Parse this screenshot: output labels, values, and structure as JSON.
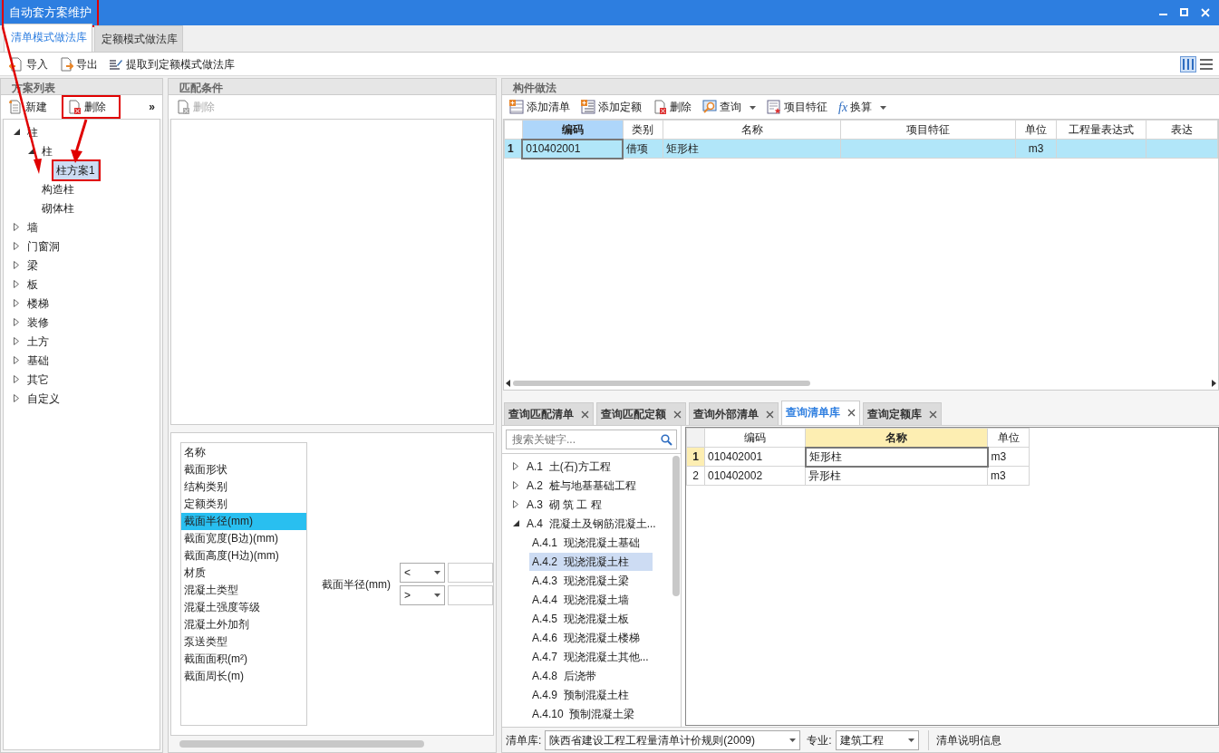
{
  "window": {
    "title": "自动套方案维护",
    "highlighted": true
  },
  "mode_tabs": [
    {
      "label": "清单模式做法库",
      "selected": true
    },
    {
      "label": "定额模式做法库",
      "selected": false
    }
  ],
  "toolbar": [
    {
      "label": "导入",
      "kind": "import"
    },
    {
      "label": "导出",
      "kind": "export"
    },
    {
      "label": "提取到定额模式做法库",
      "kind": "extract"
    }
  ],
  "scheme_panel": {
    "title": "方案列表",
    "more": "»",
    "buttons": [
      {
        "label": "新建",
        "kind": "new",
        "highlighted": false
      },
      {
        "label": "删除",
        "kind": "delete",
        "highlighted": true
      }
    ],
    "tree": [
      {
        "label": "柱",
        "expanded": true,
        "selected": false,
        "highlighted": false,
        "children": [
          {
            "label": "柱",
            "expanded": true,
            "selected": false,
            "highlighted": false,
            "children": [
              {
                "label": "柱方案1",
                "selected": true,
                "highlighted": true
              }
            ]
          },
          {
            "label": "构造柱",
            "selected": false,
            "highlighted": false
          },
          {
            "label": "砌体柱",
            "selected": false,
            "highlighted": false
          }
        ]
      },
      {
        "label": "墙",
        "expanded": false,
        "selected": false,
        "highlighted": false
      },
      {
        "label": "门窗洞",
        "expanded": false,
        "selected": false,
        "highlighted": false
      },
      {
        "label": "梁",
        "expanded": false,
        "selected": false,
        "highlighted": false
      },
      {
        "label": "板",
        "expanded": false,
        "selected": false,
        "highlighted": false
      },
      {
        "label": "楼梯",
        "expanded": false,
        "selected": false,
        "highlighted": false
      },
      {
        "label": "装修",
        "expanded": false,
        "selected": false,
        "highlighted": false
      },
      {
        "label": "土方",
        "expanded": false,
        "selected": false,
        "highlighted": false
      },
      {
        "label": "基础",
        "expanded": false,
        "selected": false,
        "highlighted": false
      },
      {
        "label": "其它",
        "expanded": false,
        "selected": false,
        "highlighted": false
      },
      {
        "label": "自定义",
        "expanded": false,
        "selected": false,
        "highlighted": false
      }
    ]
  },
  "match_panel": {
    "title": "匹配条件",
    "buttons": [
      {
        "label": "删除",
        "disabled": true
      }
    ],
    "attributes": [
      {
        "label": "名称",
        "selected": false
      },
      {
        "label": "截面形状",
        "selected": false
      },
      {
        "label": "结构类别",
        "selected": false
      },
      {
        "label": "定额类别",
        "selected": false
      },
      {
        "label": "截面半径(mm)",
        "selected": true
      },
      {
        "label": "截面宽度(B边)(mm)",
        "selected": false
      },
      {
        "label": "截面高度(H边)(mm)",
        "selected": false
      },
      {
        "label": "材质",
        "selected": false
      },
      {
        "label": "混凝土类型",
        "selected": false
      },
      {
        "label": "混凝土强度等级",
        "selected": false
      },
      {
        "label": "混凝土外加剂",
        "selected": false
      },
      {
        "label": "泵送类型",
        "selected": false
      },
      {
        "label": "截面面积(m²)",
        "selected": false
      },
      {
        "label": "截面周长(m)",
        "selected": false
      }
    ],
    "condition": {
      "label": "截面半径(mm)",
      "operators": [
        "<",
        ">"
      ]
    }
  },
  "component_panel": {
    "title": "构件做法",
    "toolbar": [
      {
        "label": "添加清单",
        "kind": "add-list",
        "dropdown": false
      },
      {
        "label": "添加定额",
        "kind": "add-quota",
        "dropdown": false
      },
      {
        "label": "删除",
        "kind": "delete",
        "dropdown": false
      },
      {
        "label": "查询",
        "kind": "search",
        "dropdown": true
      },
      {
        "label": "项目特征",
        "kind": "feature",
        "dropdown": false
      },
      {
        "label": "换算",
        "kind": "formula",
        "icon_text": "fx",
        "dropdown": true
      }
    ],
    "columns": [
      {
        "label": "编码",
        "highlighted": true
      },
      {
        "label": "类别",
        "highlighted": false
      },
      {
        "label": "名称",
        "highlighted": false
      },
      {
        "label": "项目特征",
        "highlighted": false
      },
      {
        "label": "单位",
        "highlighted": false
      },
      {
        "label": "工程量表达式",
        "highlighted": false
      },
      {
        "label": "表达",
        "highlighted": false
      }
    ],
    "rows": [
      {
        "index": "1",
        "code": "010402001",
        "type": "借项",
        "name": "矩形柱",
        "unit": "m3",
        "selected": true
      }
    ]
  },
  "query_tabs": [
    {
      "label": "查询匹配清单",
      "selected": false
    },
    {
      "label": "查询匹配定额",
      "selected": false
    },
    {
      "label": "查询外部清单",
      "selected": false
    },
    {
      "label": "查询清单库",
      "selected": true
    },
    {
      "label": "查询定额库",
      "selected": false
    }
  ],
  "library": {
    "search": {
      "placeholder": "搜索关键字..."
    },
    "tree": [
      {
        "code": "A.1",
        "label": "土(石)方工程",
        "expanded": false,
        "selected": false
      },
      {
        "code": "A.2",
        "label": "桩与地基基础工程",
        "expanded": false,
        "selected": false
      },
      {
        "code": "A.3",
        "label": "砌 筑 工 程",
        "expanded": false,
        "selected": false
      },
      {
        "code": "A.4",
        "label": "混凝土及钢筋混凝土...",
        "expanded": true,
        "selected": false,
        "children": [
          {
            "code": "A.4.1",
            "label": "现浇混凝土基础",
            "selected": false
          },
          {
            "code": "A.4.2",
            "label": "现浇混凝土柱",
            "selected": true
          },
          {
            "code": "A.4.3",
            "label": "现浇混凝土梁",
            "selected": false
          },
          {
            "code": "A.4.4",
            "label": "现浇混凝土墙",
            "selected": false
          },
          {
            "code": "A.4.5",
            "label": "现浇混凝土板",
            "selected": false
          },
          {
            "code": "A.4.6",
            "label": "现浇混凝土楼梯",
            "selected": false
          },
          {
            "code": "A.4.7",
            "label": "现浇混凝土其他...",
            "selected": false
          },
          {
            "code": "A.4.8",
            "label": "后浇带",
            "selected": false
          },
          {
            "code": "A.4.9",
            "label": "预制混凝土柱",
            "selected": false
          },
          {
            "code": "A.4.10",
            "label": "预制混凝土梁",
            "selected": false
          }
        ]
      }
    ],
    "columns": [
      {
        "label": "编码",
        "highlighted": false
      },
      {
        "label": "名称",
        "highlighted": true
      },
      {
        "label": "单位",
        "highlighted": false
      }
    ],
    "rows": [
      {
        "index": "1",
        "code": "010402001",
        "name": "矩形柱",
        "unit": "m3",
        "selected": true
      },
      {
        "index": "2",
        "code": "010402002",
        "name": "异形柱",
        "unit": "m3",
        "selected": false
      }
    ]
  },
  "footer": {
    "library_label": "清单库:",
    "library_value": "陕西省建设工程工程量清单计价规则(2009)",
    "major_label": "专业:",
    "major_value": "建筑工程",
    "info_button": "清单说明信息"
  }
}
